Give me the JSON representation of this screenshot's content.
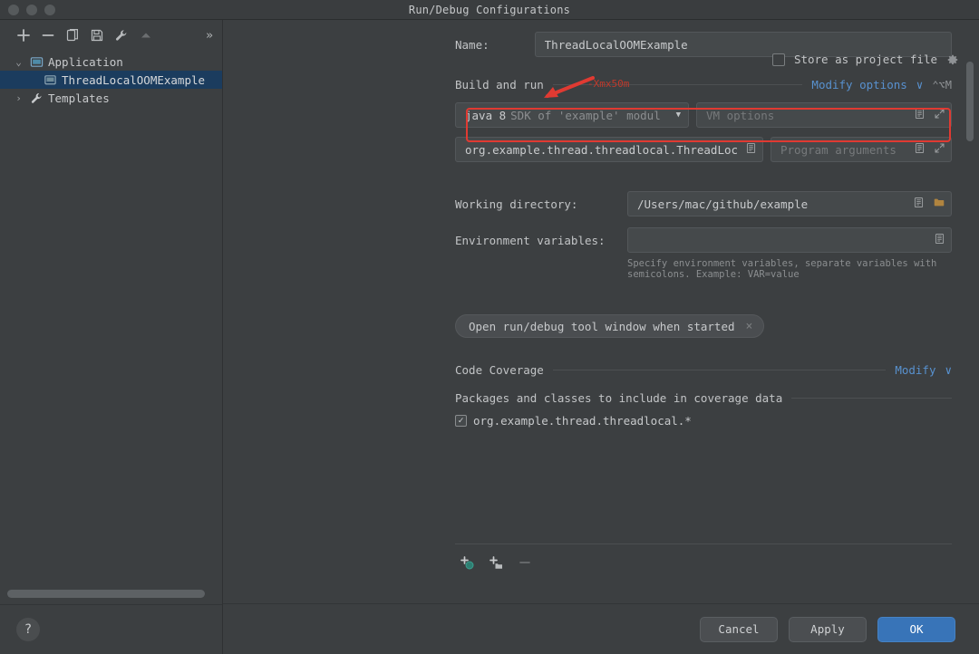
{
  "window": {
    "title": "Run/Debug Configurations"
  },
  "sidebar": {
    "toolbar": [
      {
        "name": "add-configuration-button",
        "icon": "plus-icon",
        "label": "+"
      },
      {
        "name": "remove-configuration-button",
        "icon": "minus-icon",
        "label": "−"
      },
      {
        "name": "copy-configuration-button",
        "icon": "copy-icon",
        "label": "copy"
      },
      {
        "name": "save-configuration-button",
        "icon": "save-icon",
        "label": "save"
      },
      {
        "name": "edit-templates-button",
        "icon": "wrench-icon",
        "label": "wrench"
      },
      {
        "name": "move-up-button",
        "icon": "triangle-up-icon",
        "label": "up"
      },
      {
        "name": "more-toolbar-button",
        "icon": "chevron-double-right-icon",
        "label": "»"
      }
    ],
    "tree": [
      {
        "label": "Application",
        "icon": "application-folder-icon",
        "twist": "⌄",
        "level": 0,
        "selected": false
      },
      {
        "label": "ThreadLocalOOMExample",
        "icon": "run-configuration-icon",
        "twist": "",
        "level": 1,
        "selected": true
      },
      {
        "label": "Templates",
        "icon": "wrench-icon",
        "twist": "›",
        "level": 0,
        "selected": false
      }
    ],
    "help_label": "?"
  },
  "form": {
    "name_label": "Name:",
    "name_value": "ThreadLocalOOMExample",
    "store_as_project_file_label": "Store as project file",
    "store_as_project_file_checked": false,
    "build_and_run_label": "Build and run",
    "modify_options_label": "Modify options",
    "modify_options_chevron": "∨",
    "modify_options_shortcut": "⌃⌥M",
    "sdk_name": "java 8",
    "sdk_desc": "SDK of 'example' modul",
    "sdk_caret": "▼",
    "vm_options_placeholder": "VM options",
    "vm_options_value": "",
    "main_class_value": "org.example.thread.threadlocal.ThreadLoca",
    "program_arguments_placeholder": "Program arguments",
    "program_arguments_value": "",
    "working_directory_label": "Working directory:",
    "working_directory_value": "/Users/mac/github/example",
    "environment_variables_label": "Environment variables:",
    "environment_variables_value": "",
    "environment_hint": "Specify environment variables, separate variables with semicolons. Example: VAR=value",
    "chip_label": "Open run/debug tool window when started",
    "chip_close": "×",
    "code_coverage_label": "Code Coverage",
    "code_coverage_modify_label": "Modify",
    "code_coverage_modify_chevron": "∨",
    "packages_header": "Packages and classes to include in coverage data",
    "coverage_items": [
      {
        "label": "org.example.thread.threadlocal.*",
        "checked": true,
        "check_glyph": "✓"
      }
    ],
    "coverage_toolbar": [
      {
        "name": "add-pattern-button",
        "icon": "plus-class-icon"
      },
      {
        "name": "add-package-button",
        "icon": "plus-folder-icon"
      },
      {
        "name": "remove-pattern-button",
        "icon": "minus-icon"
      }
    ]
  },
  "annotation": {
    "text": "-Xmx50m",
    "box_color": "#e03a32",
    "text_color": "#c0392b"
  },
  "buttons": {
    "cancel": "Cancel",
    "apply": "Apply",
    "ok": "OK"
  }
}
